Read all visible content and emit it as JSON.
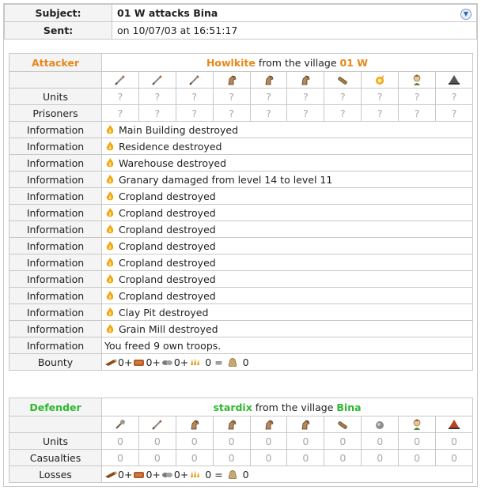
{
  "header": {
    "subject_label": "Subject:",
    "subject_value": "01 W attacks Bina",
    "sent_label": "Sent:",
    "sent_value": "on 10/07/03 at 16:51:17"
  },
  "attacker": {
    "role_label": "Attacker",
    "player": "Howlkite",
    "from_text": "from the village",
    "village": "01 W",
    "unit_icons": [
      "sword-icon",
      "sword-icon",
      "sword-icon",
      "horse-icon",
      "horse-icon",
      "horse-icon",
      "ram-icon",
      "fireball-icon",
      "chief-icon",
      "settler-icon"
    ],
    "units_label": "Units",
    "units": [
      "?",
      "?",
      "?",
      "?",
      "?",
      "?",
      "?",
      "?",
      "?",
      "?"
    ],
    "prisoners_label": "Prisoners",
    "prisoners": [
      "?",
      "?",
      "?",
      "?",
      "?",
      "?",
      "?",
      "?",
      "?",
      "?"
    ],
    "info_label": "Information",
    "information": [
      "Main Building destroyed",
      "Residence destroyed",
      "Warehouse destroyed",
      "Granary damaged from level 14 to level 11",
      "Cropland destroyed",
      "Cropland destroyed",
      "Cropland destroyed",
      "Cropland destroyed",
      "Cropland destroyed",
      "Cropland destroyed",
      "Cropland destroyed",
      "Clay Pit destroyed",
      "Grain Mill destroyed"
    ],
    "freed_text": "You freed 9 own troops.",
    "bounty_label": "Bounty",
    "bounty": {
      "wood": "0",
      "clay": "0",
      "iron": "0",
      "crop": "0",
      "total": "0"
    }
  },
  "defender": {
    "role_label": "Defender",
    "player": "stardix",
    "from_text": "from the village",
    "village": "Bina",
    "unit_icons": [
      "mace-icon",
      "sword-icon",
      "horse-icon",
      "horse-icon",
      "horse-icon",
      "horse-icon",
      "ram-icon",
      "catapult-icon",
      "chief-icon",
      "settler-icon"
    ],
    "units_label": "Units",
    "units": [
      "0",
      "0",
      "0",
      "0",
      "0",
      "0",
      "0",
      "0",
      "0",
      "0"
    ],
    "casualties_label": "Casualties",
    "casualties": [
      "0",
      "0",
      "0",
      "0",
      "0",
      "0",
      "0",
      "0",
      "0",
      "0"
    ],
    "losses_label": "Losses",
    "losses": {
      "wood": "0",
      "clay": "0",
      "iron": "0",
      "crop": "0",
      "total": "0"
    }
  },
  "colors": {
    "attacker": "#e8871a",
    "defender": "#2fb82f",
    "border": "#c8c8c8"
  }
}
